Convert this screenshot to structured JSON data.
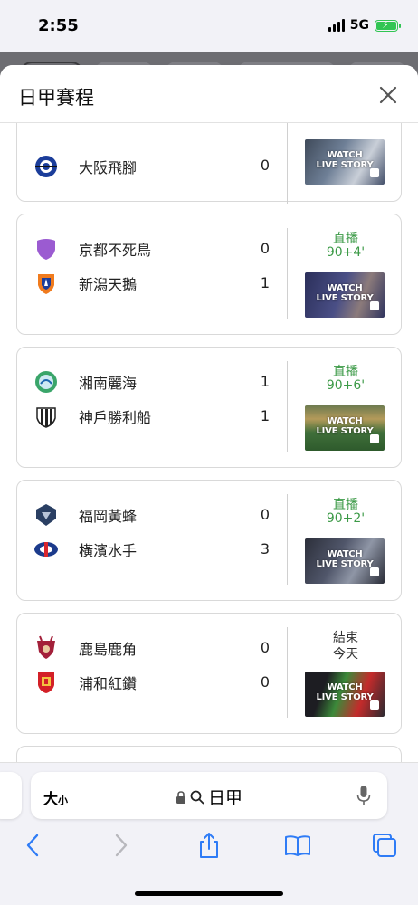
{
  "status_bar": {
    "time": "2:55",
    "network": "5G"
  },
  "sheet": {
    "title": "日甲賽程"
  },
  "matches": [
    {
      "home": "",
      "home_score": "",
      "away": "大阪飛腳",
      "away_score": "0",
      "status1": "",
      "status2": "",
      "status_type": "live",
      "thumb_text": "WATCH LIVE STORY"
    },
    {
      "home": "京都不死鳥",
      "home_score": "0",
      "away": "新潟天鵝",
      "away_score": "1",
      "status1": "直播",
      "status2": "90+4'",
      "status_type": "live",
      "thumb_text": "WATCH LIVE STORY"
    },
    {
      "home": "湘南麗海",
      "home_score": "1",
      "away": "神戶勝利船",
      "away_score": "1",
      "status1": "直播",
      "status2": "90+6'",
      "status_type": "live",
      "thumb_text": "WATCH LIVE STORY"
    },
    {
      "home": "福岡黃蜂",
      "home_score": "0",
      "away": "橫濱水手",
      "away_score": "3",
      "status1": "直播",
      "status2": "90+2'",
      "status_type": "live",
      "thumb_text": "WATCH LIVE STORY"
    },
    {
      "home": "鹿島鹿角",
      "home_score": "0",
      "away": "浦和紅鑽",
      "away_score": "0",
      "status1": "結束",
      "status2": "今天",
      "status_type": "ended",
      "thumb_text": "WATCH LIVE STORY"
    }
  ],
  "address_bar": {
    "text_size_label": "大",
    "text_size_small": "小",
    "query": "日甲"
  },
  "colors": {
    "live": "#3c9a47",
    "battery": "#31c553",
    "ios_blue": "#2f7cf6"
  }
}
